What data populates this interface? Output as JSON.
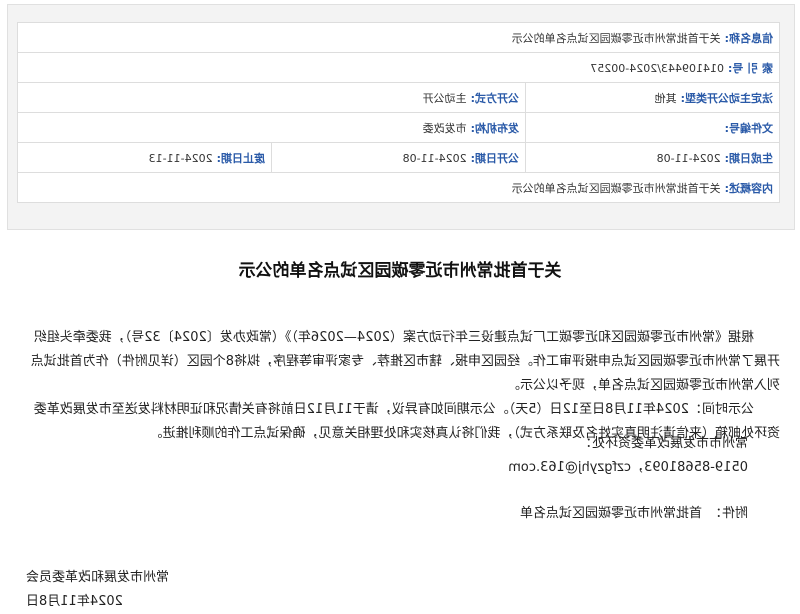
{
  "meta": {
    "info_name_label": "信息名称:",
    "info_name_value": "关于首批常州市近零碳园区试点名单的公示",
    "index_label": "索 引 号:",
    "index_value": "014109443/2024-00257",
    "legal_method_label": "法定主动公开类型:",
    "legal_method_value": "其他",
    "open_method_label": "公开方式:",
    "open_method_value": "主动公开",
    "doc_number_label": "文件编号:",
    "doc_number_value": "",
    "issuer_label": "发布机构:",
    "issuer_value": "市发改委",
    "gen_date_label": "生成日期:",
    "gen_date_value": "2024-11-08",
    "open_date_label": "公开日期:",
    "open_date_value": "2024-11-08",
    "expire_date_label": "废止日期:",
    "expire_date_value": "2024-11-13",
    "summary_label": "内容概述:",
    "summary_value": "关于首批常州市近零碳园区试点名单的公示"
  },
  "article": {
    "title": "关于首批常州市近零碳园区试点名单的公示",
    "p1": "根据《常州市近零碳园区和近零碳工厂试点建设三年行动方案（2024—2026年）》（常政办发〔2024〕32号），我委牵头组织开展了常州市近零碳园区试点申报评审工作。经园区申报、辖市区推荐、专家评审等程序，拟将8个园区（详见附件）作为首批试点列入常州市近零碳园区试点名单，现予以公示。",
    "p2": "公示时间：2024年11月8日至12日（5天）。公示期间如有异议，请于11月12日前将有关情况和证明材料发送至市发展改革委资环处邮箱（来信请注明真实姓名及联系方式），我们将认真核实和处理相关意见，确保试点工作的顺利推进。",
    "contact_unit": "常州市市发展改革委资环处：",
    "contact_tel": "0519-85681093，czfgzyhj@163.com",
    "attachment_label": "附件：",
    "attachment_name": "首批常州市近零碳园区试点名单",
    "signature": "常州市发展和改革委员会",
    "date": "2024年11月8日"
  }
}
